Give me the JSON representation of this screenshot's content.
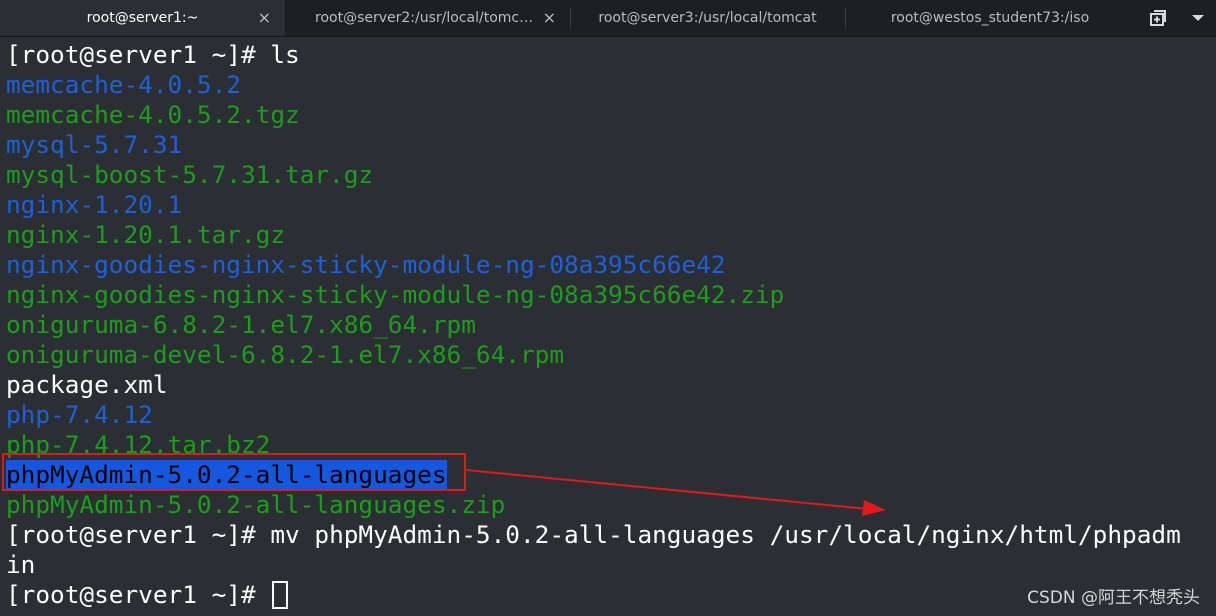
{
  "tabs": [
    {
      "label": "root@server1:~",
      "active": true,
      "close": "×"
    },
    {
      "label": "root@server2:/usr/local/tomca…",
      "active": false,
      "close": "×"
    },
    {
      "label": "root@server3:/usr/local/tomcat",
      "active": false
    },
    {
      "label": "root@westos_student73:/iso",
      "active": false
    }
  ],
  "tab_buttons": {
    "new_tab_icon": "new-tab-icon",
    "menu_icon": "chevron-down-icon"
  },
  "terminal": {
    "prompt": "[root@server1 ~]# ",
    "commands": {
      "ls": "ls",
      "mv": "mv phpMyAdmin-5.0.2-all-languages /usr/local/nginx/html/phpadm",
      "mv_wrap": "in"
    },
    "listing": [
      {
        "name": "memcache-4.0.5.2",
        "type": "dir"
      },
      {
        "name": "memcache-4.0.5.2.tgz",
        "type": "archive"
      },
      {
        "name": "mysql-5.7.31",
        "type": "dir"
      },
      {
        "name": "mysql-boost-5.7.31.tar.gz",
        "type": "archive"
      },
      {
        "name": "nginx-1.20.1",
        "type": "dir"
      },
      {
        "name": "nginx-1.20.1.tar.gz",
        "type": "archive"
      },
      {
        "name": "nginx-goodies-nginx-sticky-module-ng-08a395c66e42",
        "type": "dir"
      },
      {
        "name": "nginx-goodies-nginx-sticky-module-ng-08a395c66e42.zip",
        "type": "archive"
      },
      {
        "name": "oniguruma-6.8.2-1.el7.x86_64.rpm",
        "type": "archive"
      },
      {
        "name": "oniguruma-devel-6.8.2-1.el7.x86_64.rpm",
        "type": "archive"
      },
      {
        "name": "package.xml",
        "type": "file"
      },
      {
        "name": "php-7.4.12",
        "type": "dir"
      },
      {
        "name": "php-7.4.12.tar.bz2",
        "type": "archive"
      },
      {
        "name": "phpMyAdmin-5.0.2-all-languages",
        "type": "dir",
        "selected": true
      },
      {
        "name": "phpMyAdmin-5.0.2-all-languages.zip",
        "type": "archive"
      }
    ]
  },
  "colors": {
    "background": "#2b2f33",
    "dir": "#1f5fdc",
    "archive": "#1d9c1d",
    "file": "#ffffff",
    "selection": "#1658dd",
    "annotation": "#e1191b"
  },
  "watermark": "CSDN @阿王不想秃头"
}
